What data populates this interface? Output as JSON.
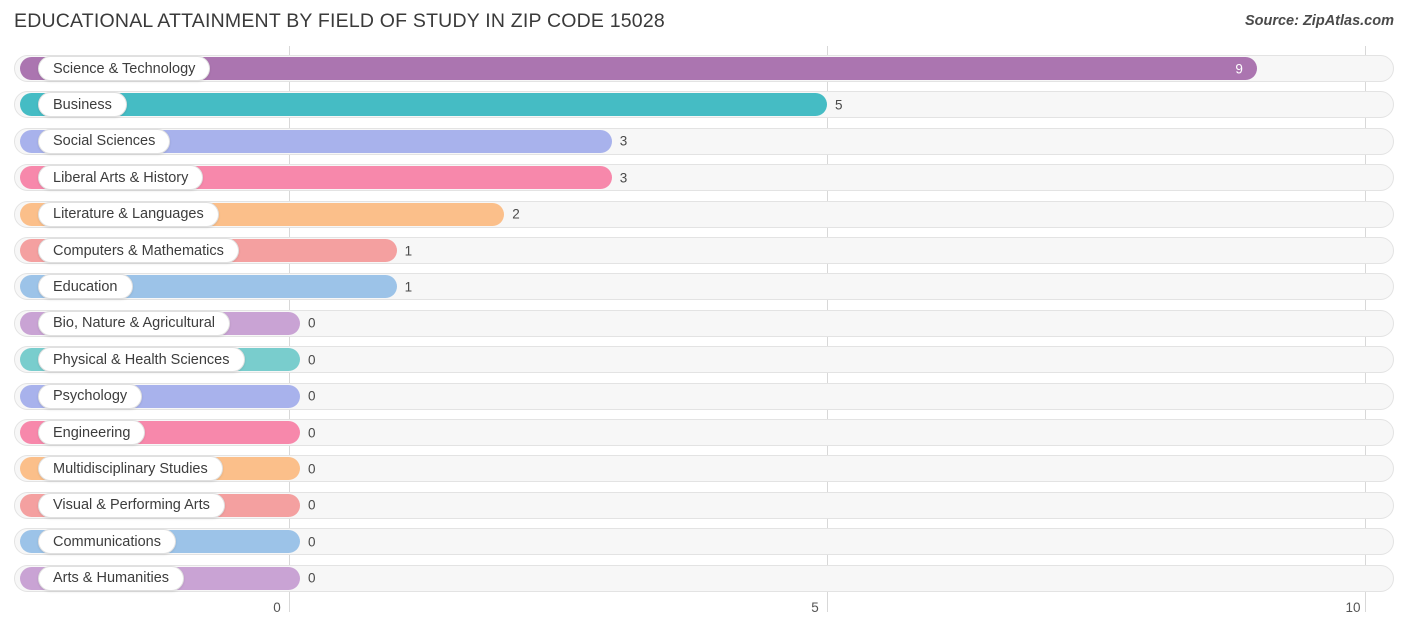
{
  "header": {
    "title": "EDUCATIONAL ATTAINMENT BY FIELD OF STUDY IN ZIP CODE 15028",
    "source": "Source: ZipAtlas.com"
  },
  "axis": {
    "ticks": [
      "0",
      "5",
      "10"
    ],
    "tick_values": [
      0,
      5,
      10
    ]
  },
  "chart_data": {
    "type": "bar",
    "orientation": "horizontal",
    "title": "EDUCATIONAL ATTAINMENT BY FIELD OF STUDY IN ZIP CODE 15028",
    "subtitle": "Source: ZipAtlas.com",
    "xlabel": "",
    "ylabel": "",
    "xlim": [
      0,
      10
    ],
    "xticks": [
      0,
      5,
      10
    ],
    "grid": true,
    "legend": false,
    "categories": [
      "Science & Technology",
      "Business",
      "Social Sciences",
      "Liberal Arts & History",
      "Literature & Languages",
      "Computers & Mathematics",
      "Education",
      "Bio, Nature & Agricultural",
      "Physical & Health Sciences",
      "Psychology",
      "Engineering",
      "Multidisciplinary Studies",
      "Visual & Performing Arts",
      "Communications",
      "Arts & Humanities"
    ],
    "values": [
      9,
      5,
      3,
      3,
      2,
      1,
      1,
      0,
      0,
      0,
      0,
      0,
      0,
      0,
      0
    ],
    "value_labels": [
      "9",
      "5",
      "3",
      "3",
      "2",
      "1",
      "1",
      "0",
      "0",
      "0",
      "0",
      "0",
      "0",
      "0",
      "0"
    ],
    "colors": [
      "#ab75b0",
      "#45bcc4",
      "#a8b2ec",
      "#f788ab",
      "#fbbf8a",
      "#f4a0a0",
      "#9cc3e8",
      "#c9a3d4",
      "#79cdcd",
      "#a8b2ec",
      "#f788ab",
      "#fbbf8a",
      "#f4a0a0",
      "#9cc3e8",
      "#c9a3d4"
    ]
  },
  "colors": {
    "track_bg": "#f7f7f7",
    "track_border": "#e3e3e3",
    "gridline": "#d8d8d8",
    "title_text": "#3a3a3a",
    "label_text": "#3d3d3d"
  }
}
